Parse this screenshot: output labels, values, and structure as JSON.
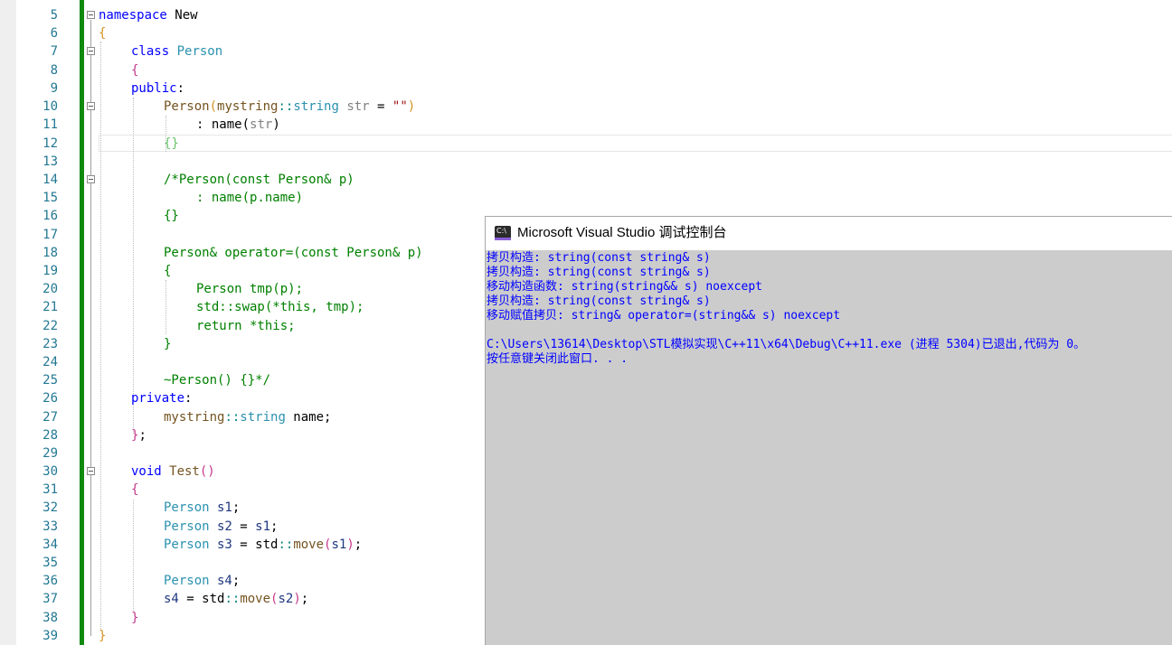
{
  "editor": {
    "line_numbers": [
      "5",
      "6",
      "7",
      "8",
      "9",
      "10",
      "11",
      "12",
      "13",
      "14",
      "15",
      "16",
      "17",
      "18",
      "19",
      "20",
      "21",
      "22",
      "23",
      "24",
      "25",
      "26",
      "27",
      "28",
      "29",
      "30",
      "31",
      "32",
      "33",
      "34",
      "35",
      "36",
      "37",
      "38",
      "39"
    ],
    "code": {
      "l5": {
        "kw": "namespace",
        "name": " New"
      },
      "l6": {
        "brace": "{"
      },
      "l7": {
        "kw": "class",
        "name": "Person"
      },
      "l8": {
        "brace": "{"
      },
      "l9": {
        "kw": "public",
        "colon": ":"
      },
      "l10": {
        "fn": "Person",
        "open": "(",
        "ns": "mystring",
        "sep": "::",
        "ty": "string",
        "var": " str",
        "eq": " = ",
        "str": "\"\"",
        "close": ")"
      },
      "l11": {
        "text": ": name(",
        "var": "str",
        "close": ")"
      },
      "l12": {
        "text": "{}"
      },
      "l14": {
        "comment": "/*Person(const Person& p)"
      },
      "l15": {
        "comment": ": name(p.name)"
      },
      "l16": {
        "comment": "{}"
      },
      "l18": {
        "comment": "Person& operator=(const Person& p)"
      },
      "l19": {
        "comment": "{"
      },
      "l20": {
        "comment": "Person tmp(p);"
      },
      "l21": {
        "comment": "std::swap(*this, tmp);"
      },
      "l22": {
        "comment": "return *this;"
      },
      "l23": {
        "comment": "}"
      },
      "l25": {
        "comment": "~Person() {}*/"
      },
      "l26": {
        "kw": "private",
        "colon": ":"
      },
      "l27": {
        "ns": "mystring",
        "sep": "::",
        "ty": "string",
        "name": " name;"
      },
      "l28": {
        "brace": "}",
        "semi": ";"
      },
      "l30": {
        "kw": "void",
        "fn": " Test",
        "parens": "()"
      },
      "l31": {
        "brace": "{"
      },
      "l32": {
        "ty": "Person",
        "var": " s1",
        "semi": ";"
      },
      "l33": {
        "ty": "Person",
        "var": " s2",
        "eq": " = ",
        "var2": "s1",
        "semi": ";"
      },
      "l34": {
        "ty": "Person",
        "var": " s3",
        "eq": " = ",
        "ns": "std",
        "sep": "::",
        "fn": "move",
        "open": "(",
        "var2": "s1",
        "close": ")",
        "semi": ";"
      },
      "l36": {
        "ty": "Person",
        "var": " s4",
        "semi": ";"
      },
      "l37": {
        "var": "s4",
        "eq": " = ",
        "ns": "std",
        "sep": "::",
        "fn": "move",
        "open": "(",
        "var2": "s2",
        "close": ")",
        "semi": ";"
      },
      "l38": {
        "brace": "}"
      },
      "l39": {
        "brace": "}"
      }
    }
  },
  "console": {
    "title": "Microsoft Visual Studio 调试控制台",
    "icon_label": "C:\\",
    "lines": [
      "拷贝构造: string(const string& s)",
      "拷贝构造: string(const string& s)",
      "移动构造函数: string(string&& s) noexcept",
      "拷贝构造: string(const string& s)",
      "移动赋值拷贝: string& operator=(string&& s) noexcept",
      "",
      "C:\\Users\\13614\\Desktop\\STL模拟实现\\C++11\\x64\\Debug\\C++11.exe (进程 5304)已退出,代码为 0。",
      "按任意键关闭此窗口. . ."
    ]
  },
  "colors": {
    "keyword": "#0000ff",
    "type": "#2b91af",
    "comment": "#008000",
    "string": "#a31515",
    "line_number": "#237893",
    "change_bar": "#108a10",
    "console_bg": "#cccccc",
    "console_text": "#0000ff"
  }
}
